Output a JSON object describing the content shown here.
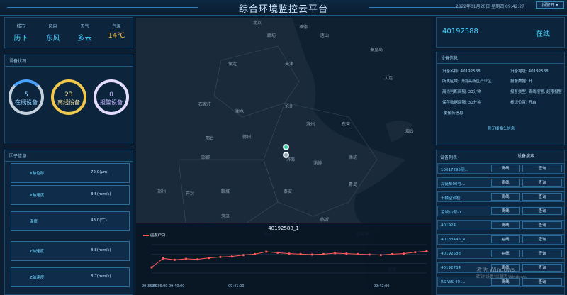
{
  "header": {
    "title": "综合环境监控云平台",
    "datetime": "2022年01月20日 星期四 09:42:27",
    "user_menu": "报警开 ▾"
  },
  "weather": [
    {
      "label": "城市",
      "value": "历下"
    },
    {
      "label": "风向",
      "value": "东风"
    },
    {
      "label": "天气",
      "value": "多云"
    },
    {
      "label": "气温",
      "value": "14℃"
    }
  ],
  "device_status": {
    "title": "设备状况",
    "online": {
      "count": "5",
      "label": "在线设备"
    },
    "offline": {
      "count": "23",
      "label": "离线设备"
    },
    "alarm": {
      "count": "0",
      "label": "报警设备"
    }
  },
  "factors": {
    "title": "因子信息",
    "items": [
      {
        "label": "X轴位移",
        "value": "72.0(μm)"
      },
      {
        "label": "X轴速度",
        "value": "8.5(mm/s)"
      },
      {
        "label": "温度",
        "value": "43.0(℃)"
      },
      {
        "label": "Y轴速度",
        "value": "8.8(mm/s)"
      },
      {
        "label": "Z轴速度",
        "value": "8.7(mm/s)"
      }
    ]
  },
  "map_labels": [
    {
      "t": "北京"
    },
    {
      "t": "廊坊"
    },
    {
      "t": "天津"
    },
    {
      "t": "保定"
    },
    {
      "t": "沧州"
    },
    {
      "t": "石家庄"
    },
    {
      "t": "衡水"
    },
    {
      "t": "德州"
    },
    {
      "t": "邢台"
    },
    {
      "t": "滨州"
    },
    {
      "t": "东营"
    },
    {
      "t": "邯郸"
    },
    {
      "t": "济南"
    },
    {
      "t": "淄博"
    },
    {
      "t": "潍坊"
    },
    {
      "t": "青岛"
    },
    {
      "t": "泰安"
    },
    {
      "t": "聊城"
    },
    {
      "t": "临沂"
    },
    {
      "t": "郑州"
    },
    {
      "t": "开封"
    },
    {
      "t": "徐州"
    },
    {
      "t": "烟台"
    },
    {
      "t": "大连"
    },
    {
      "t": "唐山"
    },
    {
      "t": "秦皇岛"
    },
    {
      "t": "承德"
    },
    {
      "t": "盐城"
    },
    {
      "t": "连云港"
    },
    {
      "t": "菏泽"
    }
  ],
  "chart": {
    "device": "40192588_1",
    "legend": "温度(℃)"
  },
  "chart_data": {
    "type": "line",
    "series": [
      {
        "name": "温度(℃)",
        "values": [
          40.2,
          42.1,
          41.8,
          42.0,
          41.9,
          42.2,
          42.4,
          42.5,
          42.8,
          43.0,
          43.5,
          43.3,
          43.1,
          43.0,
          42.9,
          43.0,
          43.2,
          43.1,
          43.0,
          42.9,
          42.8,
          43.0,
          43.1,
          43.4,
          43.6
        ]
      }
    ],
    "x_ticks": [
      "09:36:00",
      "09:36:00",
      "09:40:00",
      "09:41:00",
      "09:42:00"
    ]
  },
  "device": {
    "id": "40192588",
    "status": "在线",
    "info_title": "设备信息",
    "lines": [
      "设备名称: 40192588",
      "设备地址: 40192588",
      "所属区域: 济南高新区产业区",
      "报警数据: 开",
      "离线判断间隔: 30分钟",
      "报警类型: 离线报警, 超限报警",
      "保存数据间隔: 30分钟",
      "标记位置: 开启"
    ],
    "camera": "摄像头信息",
    "no_camera": "暂无摄像头信息"
  },
  "device_list": {
    "title": "设备列表",
    "search": "设备搜索",
    "items": [
      {
        "name": "10017295测...",
        "status": "离线",
        "action": "查询"
      },
      {
        "name": "冷链车00号...",
        "status": "离线",
        "action": "查询"
      },
      {
        "name": "十楼空调检...",
        "status": "离线",
        "action": "查询"
      },
      {
        "name": "凉城12号-1",
        "status": "离线",
        "action": "查询"
      },
      {
        "name": "401924",
        "status": "离线",
        "action": "查询"
      },
      {
        "name": "40183445_4...",
        "status": "在线",
        "action": "查询"
      },
      {
        "name": "40192588",
        "status": "在线",
        "action": "查询"
      },
      {
        "name": "40192784",
        "status": "离线",
        "action": "查询"
      },
      {
        "name": "RS-WS-40-...",
        "status": "离线",
        "action": "查询"
      }
    ]
  },
  "watermark": {
    "line1": "激活 Windows",
    "line2": "转到\"设置\"以激活 Windows。"
  },
  "colors": {
    "accent": "#44d4ff",
    "online": "#4aa3ff",
    "offline": "#f2c94c",
    "alarm": "#c9b7ff",
    "line": "#ff5a5a"
  }
}
